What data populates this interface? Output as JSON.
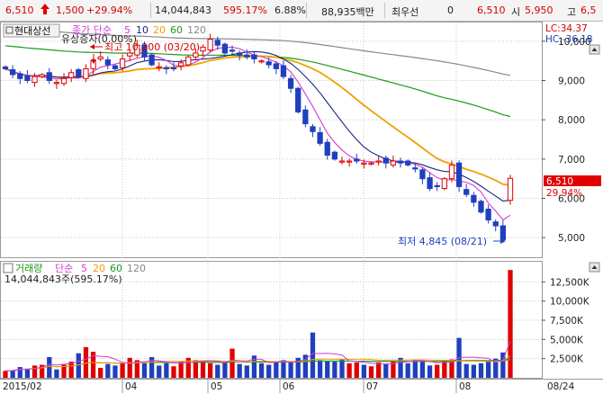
{
  "quote_bar": {
    "price": "6,510",
    "up_arrow_icon": "up-arrow-icon",
    "change": "1,500",
    "change_pct": "+29.94%",
    "volume": "14,044,843",
    "volume_ratio": "595.17%",
    "turnover": "6.88%",
    "trade_amount": "88,935백만",
    "low_label": "최우선",
    "low_value": "0",
    "last_price": "6,510",
    "open_label": "시",
    "open_value": "5,950",
    "high_label": "고",
    "high_value": "6,5"
  },
  "price_panel": {
    "stock_name": "현대상선",
    "ma_label": "종가 단순",
    "ma_periods": [
      "5",
      "10",
      "20",
      "60",
      "120"
    ],
    "capital_increase": "유상증자(0.00%)",
    "max_annotation": "최고 10,200 (03/20)",
    "min_annotation": "최저 4,845 (08/21)",
    "lc": "LC:34.37",
    "hc": "HC:-36.18",
    "current_price_tag": "6,510",
    "current_change_tag": "29.94%",
    "y_ticks": [
      "10,000",
      "9,000",
      "8,000",
      "7,000",
      "6,000",
      "5,000"
    ]
  },
  "volume_panel": {
    "title": "거래량",
    "ma_label": "단순",
    "ma_periods": [
      "5",
      "20",
      "60",
      "120"
    ],
    "volume_value": "14,044,843주(595.17%)",
    "y_ticks": [
      "12,500K",
      "10,000K",
      "7,500K",
      "5,000K",
      "2,500K"
    ]
  },
  "x_axis": {
    "labels": [
      "2015/02",
      "04",
      "05",
      "06",
      "07",
      "08"
    ],
    "right_date": "08/24"
  },
  "colors": {
    "up": "#e00000",
    "down": "#1f3fbf",
    "ma5": "#d43bd4",
    "ma10": "#1a237e",
    "ma20": "#f0a000",
    "ma60": "#1a9a1a",
    "ma120": "#888888",
    "background": "#ffffff",
    "grid": "#c8c8c8"
  },
  "chart_data": [
    {
      "type": "candlestick",
      "title": "현대상선",
      "x_labels": [
        "2015/02",
        "04",
        "05",
        "06",
        "07",
        "08"
      ],
      "ylim": [
        4500,
        10500
      ],
      "series_close_approx": [
        9300,
        9150,
        9050,
        9000,
        9100,
        9150,
        9000,
        8950,
        9050,
        9200,
        9100,
        9300,
        9500,
        9600,
        9400,
        9300,
        9550,
        9700,
        9900,
        9600,
        9400,
        9350,
        9300,
        9300,
        9450,
        9600,
        9700,
        9850,
        10050,
        9900,
        9700,
        9750,
        9650,
        9600,
        9550,
        9500,
        9400,
        9300,
        9100,
        8800,
        8200,
        7900,
        7700,
        7400,
        7100,
        7000,
        6950,
        6950,
        6950,
        6900,
        6900,
        6950,
        6900,
        6950,
        6900,
        6850,
        6750,
        6500,
        6250,
        6300,
        6500,
        6850,
        6300,
        6100,
        5900,
        5650,
        5450,
        5300,
        4950,
        6510
      ],
      "annotations": {
        "max": "10,200 (03/20)",
        "min": "4,845 (08/21)",
        "last": 6510
      }
    },
    {
      "type": "bar",
      "title": "거래량",
      "unit": "K",
      "ylim": [
        0,
        15000
      ],
      "values_approx_k": [
        900,
        1000,
        1400,
        1200,
        1600,
        1700,
        2700,
        1100,
        1700,
        2100,
        3200,
        4000,
        3400,
        1300,
        1800,
        1600,
        2000,
        2600,
        2300,
        1900,
        2700,
        1600,
        1900,
        1500,
        2100,
        2600,
        2300,
        2200,
        1900,
        1700,
        2000,
        3800,
        1800,
        1600,
        2900,
        1900,
        1700,
        2100,
        2300,
        2000,
        2600,
        3000,
        5900,
        2300,
        2200,
        2100,
        2400,
        1900,
        2000,
        1700,
        1500,
        2000,
        1800,
        2200,
        2600,
        1900,
        2400,
        2100,
        1600,
        1700,
        2300,
        2400,
        5200,
        1800,
        1700,
        1900,
        2100,
        2500,
        3300,
        14045
      ]
    }
  ]
}
